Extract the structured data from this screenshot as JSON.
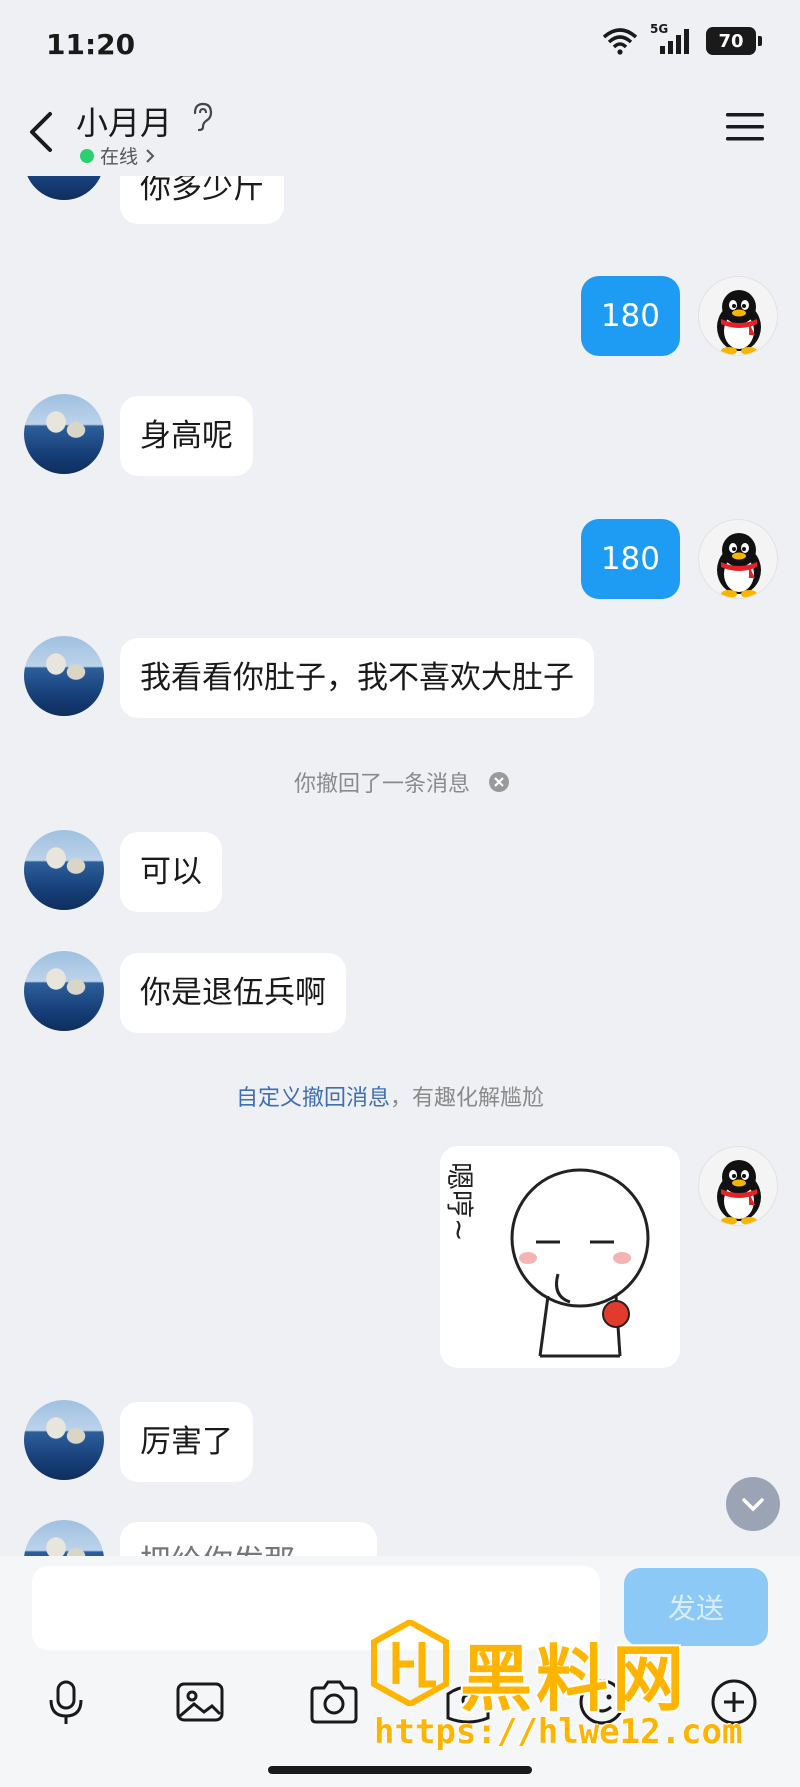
{
  "status_bar": {
    "time": "11:20",
    "network": "5G",
    "battery": "70"
  },
  "header": {
    "contact_name": "小月月",
    "online_status": "在线"
  },
  "chat": {
    "messages": [
      {
        "from": "contact",
        "text": "你多少斤"
      },
      {
        "from": "me",
        "text": "180"
      },
      {
        "from": "contact",
        "text": "身高呢"
      },
      {
        "from": "me",
        "text": "180"
      },
      {
        "from": "contact",
        "text": "我看看你肚子，我不喜欢大肚子"
      },
      {
        "from": "contact",
        "text": "可以"
      },
      {
        "from": "contact",
        "text": "你是退伍兵啊"
      },
      {
        "from": "me",
        "type": "sticker",
        "text": "嗯哼~"
      },
      {
        "from": "contact",
        "text": "厉害了"
      },
      {
        "from": "contact",
        "text": "把给你发那……"
      }
    ],
    "recall_notice": "你撤回了一条消息",
    "custom_recall_link": "自定义撤回消息",
    "custom_recall_suffix": "，有趣化解尴尬"
  },
  "input": {
    "placeholder": "",
    "send_label": "发送"
  },
  "toolbar": {
    "icons": [
      "microphone-icon",
      "image-icon",
      "camera-icon",
      "red-packet-icon",
      "emoji-icon",
      "plus-icon"
    ]
  },
  "watermark": {
    "title": "黑料网",
    "url": "https://hlwe12.com"
  },
  "colors": {
    "my_bubble": "#1e9bf2",
    "background": "#eef0f4",
    "online": "#2bd16f",
    "watermark": "#ffb400"
  }
}
